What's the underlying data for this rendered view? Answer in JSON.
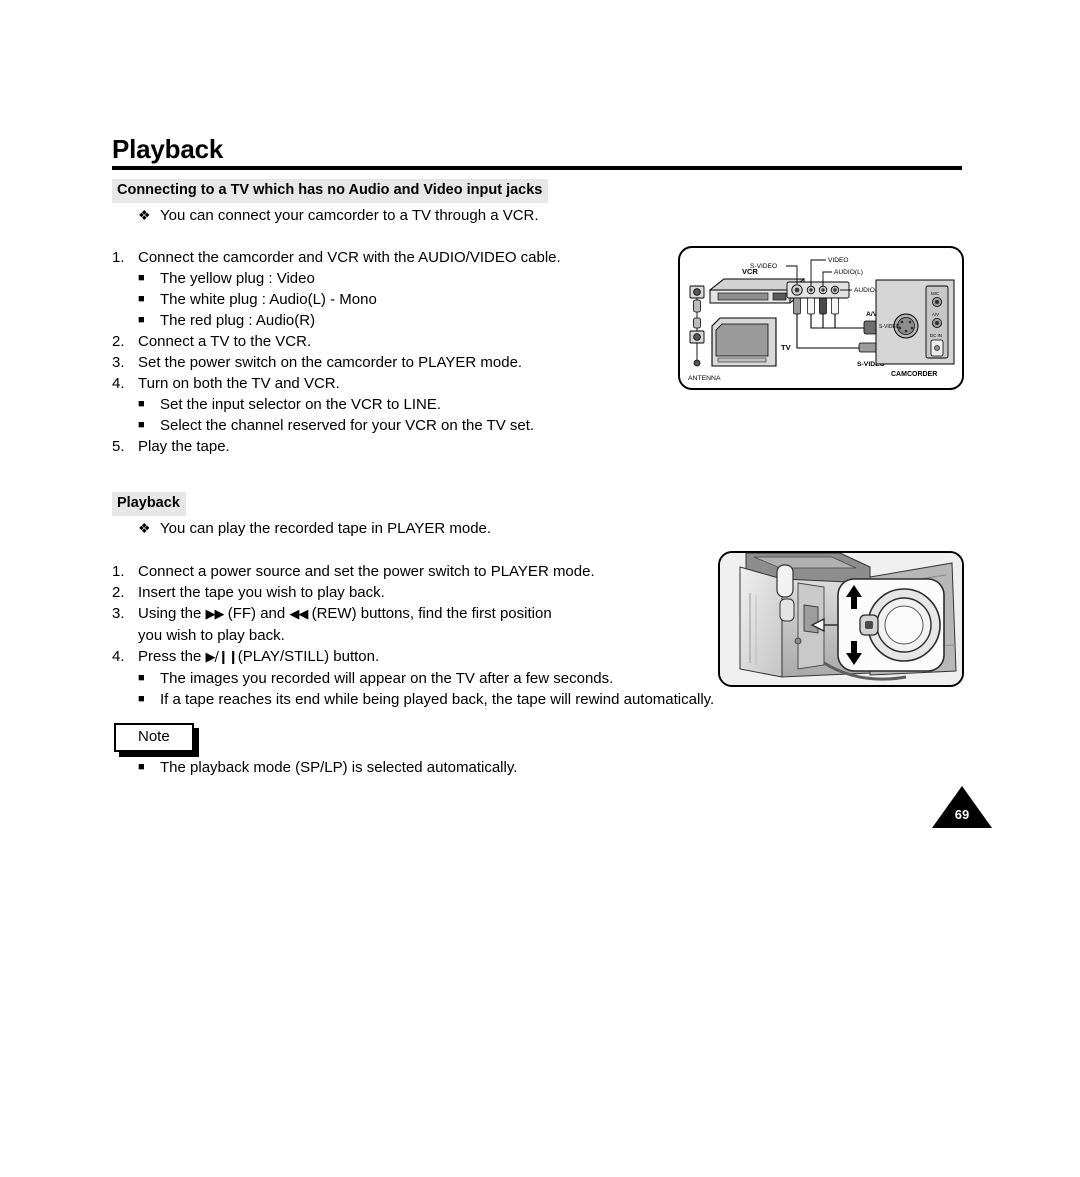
{
  "document": {
    "title": "Playback",
    "page_number": "69"
  },
  "section_one": {
    "heading": "Connecting to a TV which has no Audio and Video input jacks",
    "intro_bullet": "You can connect your camcorder to a TV through a VCR.",
    "bullet_glyph": "❖",
    "square_glyph": "■",
    "steps": [
      {
        "num": "1.",
        "text": "Connect the camcorder and VCR with the AUDIO/VIDEO cable.",
        "subs": [
          "The yellow plug :  Video",
          "The white plug :  Audio(L) - Mono",
          "The red plug :  Audio(R)"
        ]
      },
      {
        "num": "2.",
        "text": "Connect a TV to the VCR.",
        "subs": []
      },
      {
        "num": "3.",
        "text": "Set the power switch on the camcorder to PLAYER mode.",
        "subs": []
      },
      {
        "num": "4.",
        "text": "Turn on both the TV and VCR.",
        "subs": [
          "Set the input selector on the VCR to LINE.",
          "Select the channel reserved for your VCR on the TV set."
        ]
      },
      {
        "num": "5.",
        "text": "Play the tape.",
        "subs": []
      }
    ]
  },
  "section_two": {
    "heading": "Playback",
    "intro_bullet": "You can play the recorded tape in PLAYER mode.",
    "steps": [
      {
        "num": "1.",
        "text": "Connect a power source and set the power switch to PLAYER mode."
      },
      {
        "num": "2.",
        "text": "Insert the tape you wish to play back."
      }
    ],
    "step3": {
      "num": "3.",
      "part1": "Using the ",
      "ff_glyph": "▶▶",
      "part2": " (FF) and ",
      "rew_glyph": "◀◀",
      "part3": "(REW) buttons, find the first position",
      "line2": "you wish to play back."
    },
    "step4": {
      "num": "4.",
      "part1": "Press the ",
      "play_glyph": "▶/❙❙",
      "part2": "(PLAY/STILL) button."
    },
    "step4_subs": [
      "The images you recorded will appear on the TV after a few seconds.",
      "If a tape reaches its end while being played back, the tape will rewind automatically."
    ]
  },
  "note": {
    "label": "Note",
    "items": [
      "The playback mode (SP/LP) is selected automatically."
    ]
  },
  "diagram": {
    "labels": {
      "vcr": "VCR",
      "tv": "TV",
      "antenna": "ANTENNA",
      "s_video_top": "S-VIDEO",
      "video": "VIDEO",
      "audio_l": "AUDIO(L)",
      "audio_r": "AUDIO(R)",
      "av": "A/V",
      "s_video_bottom": "S-VIDEO",
      "camcorder": "CAMCORDER",
      "jack_s_video": "S-VIDEO",
      "jack_mic": "MIC",
      "jack_av": "A/V",
      "jack_dc_in": "DC IN"
    }
  },
  "colors": {
    "header_band": "#e7e7e7",
    "text": "#000000",
    "page_background": "#ffffff"
  }
}
